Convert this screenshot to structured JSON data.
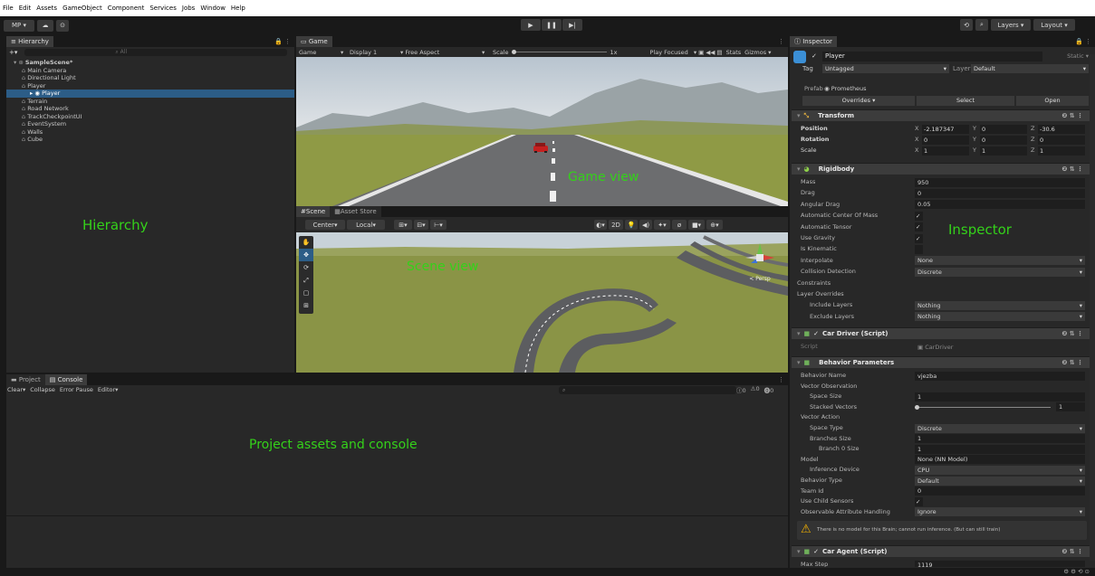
{
  "menu": [
    "File",
    "Edit",
    "Assets",
    "GameObject",
    "Component",
    "Services",
    "Jobs",
    "Window",
    "Help"
  ],
  "toolbar": {
    "account": "MP ▾",
    "layers": "Layers",
    "layout": "Layout"
  },
  "hierarchy": {
    "tab": "Hierarchy",
    "search_placeholder": "All",
    "items": [
      {
        "label": "SampleScene*",
        "indent": 0
      },
      {
        "label": "Main Camera",
        "indent": 1
      },
      {
        "label": "Directional Light",
        "indent": 1
      },
      {
        "label": "Player",
        "indent": 1
      },
      {
        "label": "Player",
        "indent": 2,
        "selected": true
      },
      {
        "label": "Terrain",
        "indent": 1
      },
      {
        "label": "Road Network",
        "indent": 1
      },
      {
        "label": "TrackCheckpointUI",
        "indent": 1
      },
      {
        "label": "EventSystem",
        "indent": 1
      },
      {
        "label": "Walls",
        "indent": 1
      },
      {
        "label": "Cube",
        "indent": 1
      }
    ],
    "annotation": "Hierarchy"
  },
  "game": {
    "tab": "Game",
    "toolbar": {
      "mode": "Game",
      "display": "Display 1",
      "aspect": "Free Aspect",
      "scale_label": "Scale",
      "scale_value": "1x",
      "play": "Play Focused",
      "stats": "Stats",
      "gizmos": "Gizmos"
    },
    "annotation": "Game view"
  },
  "scene": {
    "tabs": [
      "Scene",
      "Asset Store"
    ],
    "toolbar": {
      "pivot": "Center",
      "space": "Local",
      "mode2d": "2D"
    },
    "gizmo_label": "< Persp",
    "annotation": "Scene view"
  },
  "bottom": {
    "tabs": [
      "Project",
      "Console"
    ],
    "console_toolbar": [
      "Clear",
      "Collapse",
      "Error Pause",
      "Editor"
    ],
    "counts": [
      "0",
      "0",
      "0"
    ],
    "annotation": "Project assets and console"
  },
  "inspector": {
    "tab": "Inspector",
    "object_name": "Player",
    "static_label": "Static",
    "tag_label": "Tag",
    "tag_value": "Untagged",
    "layer_label": "Layer",
    "layer_value": "Default",
    "prefab_label": "Prefab",
    "prefab_value": "Prometheus",
    "overrides": "Overrides",
    "select": "Select",
    "open": "Open",
    "transform": {
      "title": "Transform",
      "position": {
        "label": "Position",
        "x": "-2.187347",
        "y": "0",
        "z": "-30.6"
      },
      "rotation": {
        "label": "Rotation",
        "x": "0",
        "y": "0",
        "z": "0"
      },
      "scale": {
        "label": "Scale",
        "x": "1",
        "y": "1",
        "z": "1"
      }
    },
    "rigidbody": {
      "title": "Rigidbody",
      "rows": [
        {
          "label": "Mass",
          "value": "950",
          "type": "box"
        },
        {
          "label": "Drag",
          "value": "0",
          "type": "box"
        },
        {
          "label": "Angular Drag",
          "value": "0.05",
          "type": "box"
        },
        {
          "label": "Automatic Center Of Mass",
          "value": "✓",
          "type": "check"
        },
        {
          "label": "Automatic Tensor",
          "value": "✓",
          "type": "check"
        },
        {
          "label": "Use Gravity",
          "value": "✓",
          "type": "check"
        },
        {
          "label": "Is Kinematic",
          "value": "",
          "type": "check"
        },
        {
          "label": "Interpolate",
          "value": "None",
          "type": "dd"
        },
        {
          "label": "Collision Detection",
          "value": "Discrete",
          "type": "dd"
        },
        {
          "label": "Constraints",
          "value": "",
          "type": "fold"
        },
        {
          "label": "Layer Overrides",
          "value": "",
          "type": "fold"
        },
        {
          "label": "Include Layers",
          "value": "Nothing",
          "type": "dd"
        },
        {
          "label": "Exclude Layers",
          "value": "Nothing",
          "type": "dd"
        }
      ]
    },
    "car_driver": {
      "title": "Car Driver (Script)",
      "script_label": "Script",
      "script_value": "CarDriver"
    },
    "behavior": {
      "title": "Behavior Parameters",
      "rows": [
        {
          "label": "Behavior Name",
          "value": "vjezba",
          "type": "box"
        },
        {
          "label": "Vector Observation",
          "value": "",
          "type": "none"
        },
        {
          "label": "Space Size",
          "value": "1",
          "type": "box"
        },
        {
          "label": "Stacked Vectors",
          "value": "1",
          "type": "slider"
        },
        {
          "label": "Vector Action",
          "value": "",
          "type": "none"
        },
        {
          "label": "Space Type",
          "value": "Discrete",
          "type": "dd"
        },
        {
          "label": "Branches Size",
          "value": "1",
          "type": "box"
        },
        {
          "label": "Branch 0 Size",
          "value": "1",
          "type": "box"
        },
        {
          "label": "Model",
          "value": "None (NN Model)",
          "type": "box"
        },
        {
          "label": "Inference Device",
          "value": "CPU",
          "type": "dd"
        },
        {
          "label": "Behavior Type",
          "value": "Default",
          "type": "dd"
        },
        {
          "label": "Team Id",
          "value": "0",
          "type": "box"
        },
        {
          "label": "Use Child Sensors",
          "value": "✓",
          "type": "check"
        },
        {
          "label": "Observable Attribute Handling",
          "value": "Ignore",
          "type": "dd"
        }
      ],
      "warning": "There is no model for this Brain; cannot run inference. (But can still train)"
    },
    "car_agent": {
      "title": "Car Agent (Script)",
      "max_step_label": "Max Step",
      "max_step_value": "1119"
    },
    "annotation": "Inspector"
  },
  "colors": {
    "annotation": "#34d11a",
    "selection": "#2c5d87",
    "sky": "#c8d2dc",
    "grass": "#8f9a45"
  }
}
